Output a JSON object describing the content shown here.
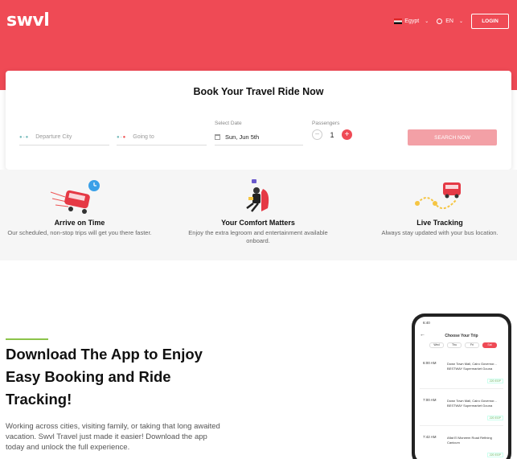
{
  "header": {
    "logo": "swvl",
    "country": "Egypt",
    "language": "EN",
    "login_label": "LOGIN"
  },
  "booking": {
    "title": "Book Your Travel Ride Now",
    "departure_placeholder": "Departure City",
    "destination_placeholder": "Going to",
    "date_label": "Select Date",
    "date_value": "Sun, Jun 5th",
    "passengers_label": "Passengers",
    "passengers_count": "1",
    "search_label": "SEARCH NOW"
  },
  "features": [
    {
      "title": "Arrive on Time",
      "desc": "Our scheduled, non-stop trips will get you there faster."
    },
    {
      "title": "Your Comfort Matters",
      "desc": "Enjoy the extra legroom and entertainment available onboard."
    },
    {
      "title": "Live Tracking",
      "desc": "Always stay updated with your bus location."
    }
  ],
  "app": {
    "title": "Download The App to Enjoy Easy Booking and Ride Tracking!",
    "desc": "Working across cities, visiting family, or taking that long awaited vacation. Swvl Travel just made it easier! Download the app today and unlock the full experience."
  },
  "phone": {
    "time": "6:40",
    "title": "Choose Your Trip",
    "days": [
      "Wed",
      "Thu",
      "Fri",
      "Sat"
    ],
    "trips": [
      {
        "time": "6:00 AM",
        "route": "Down Town Mall, Cairo Governor... BESTWAY Supermarket Gouna",
        "price": "220 EGP"
      },
      {
        "time": "7:00 AM",
        "route": "Down Town Mall, Cairo Governor... BESTWAY Supermarket Gouna",
        "price": "220 EGP"
      },
      {
        "time": "7:42 AM",
        "route": "Aflat El Moneem Road Refining Canicum",
        "price": "220 EGP"
      }
    ]
  },
  "colors": {
    "brand": "#ef4a55",
    "accent_green": "#8bc34a"
  }
}
